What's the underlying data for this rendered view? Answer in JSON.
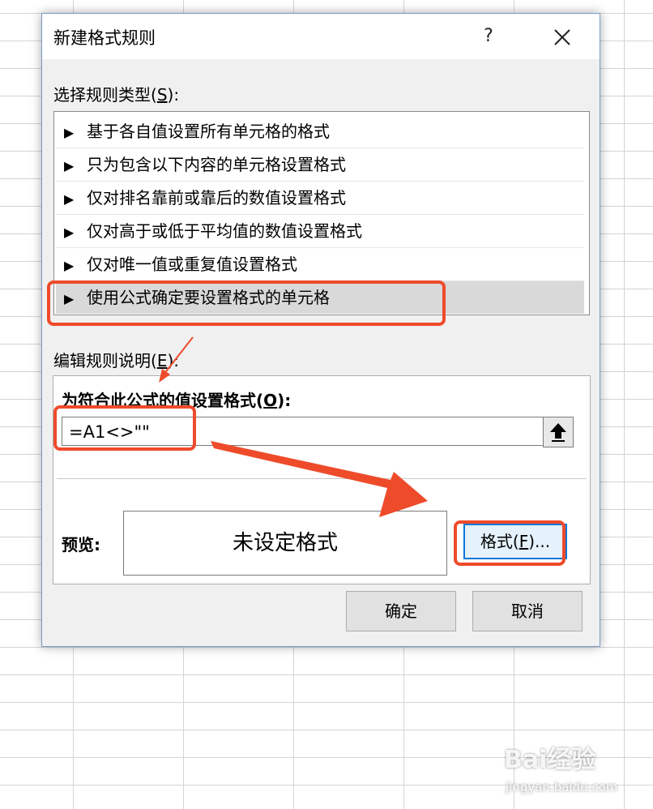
{
  "dialog": {
    "title": "新建格式规则",
    "help_label": "?",
    "close_icon": "close-icon"
  },
  "rule_types": {
    "label_pre": "选择规则类型(",
    "label_key": "S",
    "label_post": "):",
    "items": [
      {
        "label": "基于各自值设置所有单元格的格式",
        "selected": false
      },
      {
        "label": "只为包含以下内容的单元格设置格式",
        "selected": false
      },
      {
        "label": "仅对排名靠前或靠后的数值设置格式",
        "selected": false
      },
      {
        "label": "仅对高于或低于平均值的数值设置格式",
        "selected": false
      },
      {
        "label": "仅对唯一值或重复值设置格式",
        "selected": false
      },
      {
        "label": "使用公式确定要设置格式的单元格",
        "selected": true
      }
    ],
    "arrow_glyph": "▶"
  },
  "edit_rule": {
    "label_pre": "编辑规则说明(",
    "label_key": "E",
    "label_post": "):",
    "formula_label_pre": "为符合此公式的值设置格式(",
    "formula_label_key": "O",
    "formula_label_post": "):",
    "formula_value": "=A1<>\"\"",
    "collapse_icon": "collapse-dialog-icon",
    "preview_label": "预览:",
    "preview_text": "未设定格式",
    "format_btn_pre": "格式(",
    "format_btn_key": "F",
    "format_btn_post": ")..."
  },
  "buttons": {
    "ok": "确定",
    "cancel": "取消"
  },
  "annotations": {
    "highlight_color": "#ee4b2b"
  },
  "watermark": {
    "logo": "Bai经验",
    "url": "jingyan.baidu.com"
  }
}
